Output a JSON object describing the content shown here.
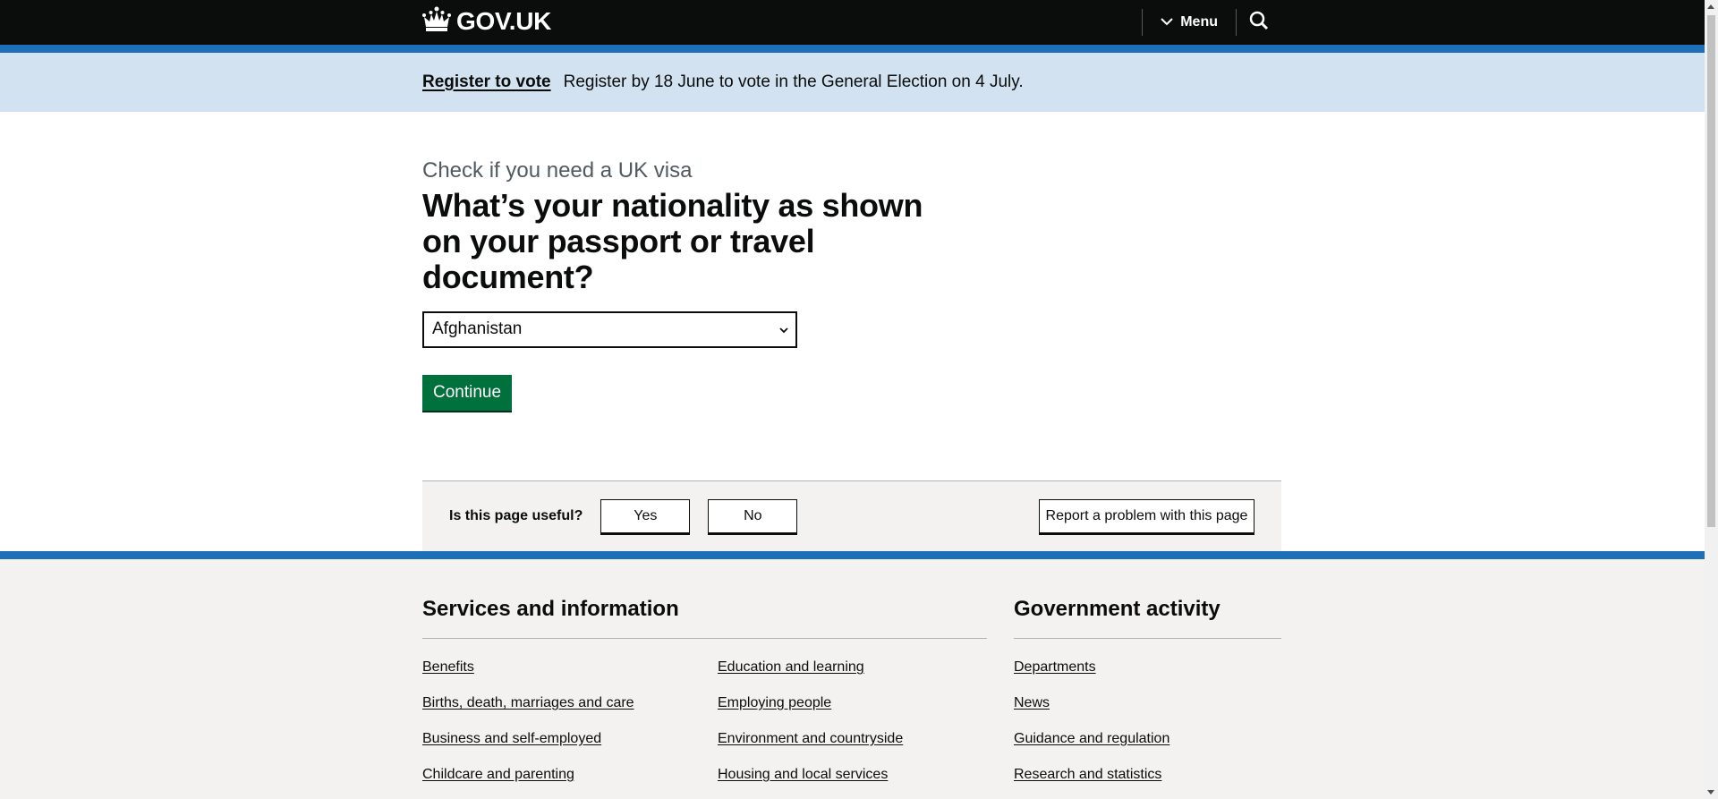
{
  "header": {
    "logo_text": "GOV.UK",
    "menu_label": "Menu",
    "logo_icon": "crown-icon",
    "search_icon": "search-icon"
  },
  "banner": {
    "link_text": "Register to vote",
    "message": "Register by 18 June to vote in the General Election on 4 July."
  },
  "main": {
    "caption": "Check if you need a UK visa",
    "question": "What’s your nationality as shown on your passport or travel document?",
    "select_value": "Afghanistan",
    "continue_label": "Continue"
  },
  "feedback": {
    "question": "Is this page useful?",
    "yes_label": "Yes",
    "no_label": "No",
    "report_label": "Report a problem with this page"
  },
  "footer": {
    "services_heading": "Services and information",
    "services_links": [
      "Benefits",
      "Education and learning",
      "Births, death, marriages and care",
      "Employing people",
      "Business and self-employed",
      "Environment and countryside",
      "Childcare and parenting",
      "Housing and local services"
    ],
    "gov_heading": "Government activity",
    "gov_links": [
      "Departments",
      "News",
      "Guidance and regulation",
      "Research and statistics"
    ]
  },
  "colors": {
    "header_bg": "#0b0c0c",
    "brand_blue": "#1d70b8",
    "banner_bg": "#d2e2f1",
    "button_green": "#00703c",
    "footer_bg": "#f3f2f1"
  }
}
